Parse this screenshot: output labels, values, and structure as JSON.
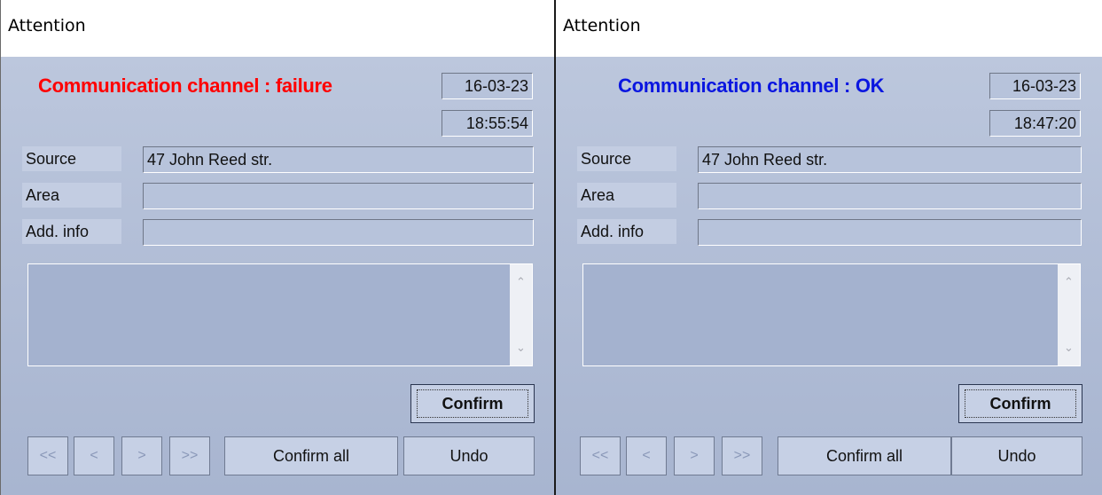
{
  "dialogs": [
    {
      "title": "Attention",
      "headline": "Communication channel : failure",
      "headline_color": "#ff0000",
      "date": "16-03-23",
      "time": "18:55:54",
      "fields": {
        "source_label": "Source",
        "source_value": "47 John Reed str.",
        "area_label": "Area",
        "area_value": "",
        "addinfo_label": "Add. info",
        "addinfo_value": ""
      },
      "buttons": {
        "confirm": "Confirm",
        "first": "<<",
        "prev": "<",
        "next": ">",
        "last": ">>",
        "confirm_all": "Confirm all",
        "undo": "Undo"
      }
    },
    {
      "title": "Attention",
      "headline": "Communication channel : OK",
      "headline_color": "#0a16e0",
      "date": "16-03-23",
      "time": "18:47:20",
      "fields": {
        "source_label": "Source",
        "source_value": "47 John Reed str.",
        "area_label": "Area",
        "area_value": "",
        "addinfo_label": "Add. info",
        "addinfo_value": ""
      },
      "buttons": {
        "confirm": "Confirm",
        "first": "<<",
        "prev": "<",
        "next": ">",
        "last": ">>",
        "confirm_all": "Confirm all",
        "undo": "Undo"
      }
    }
  ],
  "icons": {
    "scroll_up": "chevron-up-icon",
    "scroll_down": "chevron-down-icon"
  }
}
